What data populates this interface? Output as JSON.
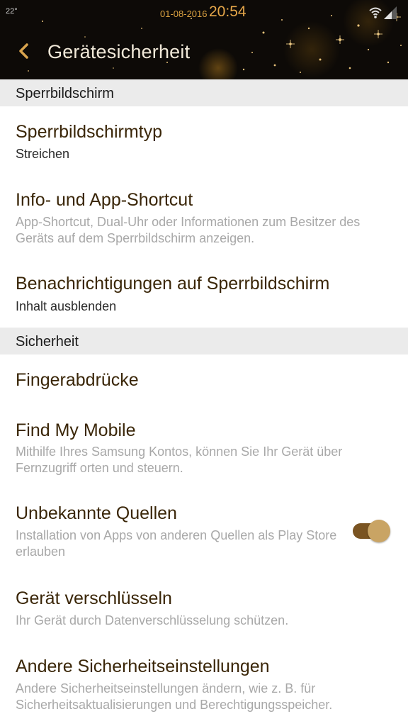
{
  "status_bar": {
    "temperature": "22°",
    "date": "01-08-2016",
    "time": "20:54"
  },
  "header": {
    "title": "Gerätesicherheit"
  },
  "sections": {
    "lock_screen": {
      "label": "Sperrbildschirm",
      "items": [
        {
          "title": "Sperrbildschirmtyp",
          "subtitle": "Streichen"
        },
        {
          "title": "Info- und App-Shortcut",
          "description": "App-Shortcut, Dual-Uhr oder Informationen zum Besitzer des Geräts auf dem Sperrbildschirm anzeigen."
        },
        {
          "title": "Benachrichtigungen auf Sperrbildschirm",
          "subtitle": "Inhalt ausblenden"
        }
      ]
    },
    "security": {
      "label": "Sicherheit",
      "items": [
        {
          "title": "Fingerabdrücke"
        },
        {
          "title": "Find My Mobile",
          "description": "Mithilfe Ihres Samsung Kontos, können Sie Ihr Gerät über Fernzugriff orten und steuern."
        },
        {
          "title": "Unbekannte Quellen",
          "description": "Installation von Apps von anderen Quellen als Play Store erlauben",
          "toggle_on": true
        },
        {
          "title": "Gerät verschlüsseln",
          "description": "Ihr Gerät durch Datenverschlüsselung schützen."
        },
        {
          "title": "Andere Sicherheitseinstellungen",
          "description": "Andere Sicherheitseinstellungen ändern, wie z. B. für Sicherheitsaktualisierungen und Berechtigungsspeicher."
        }
      ]
    }
  },
  "colors": {
    "header_bg": "#0d0a07",
    "accent_gold": "#c9a464",
    "title_text": "#3a2608",
    "section_bg": "#ebebeb",
    "description_text": "#a8a8a8"
  },
  "icons": {
    "back": "chevron-left-icon",
    "wifi": "wifi-icon",
    "signal": "cellular-signal-icon"
  }
}
